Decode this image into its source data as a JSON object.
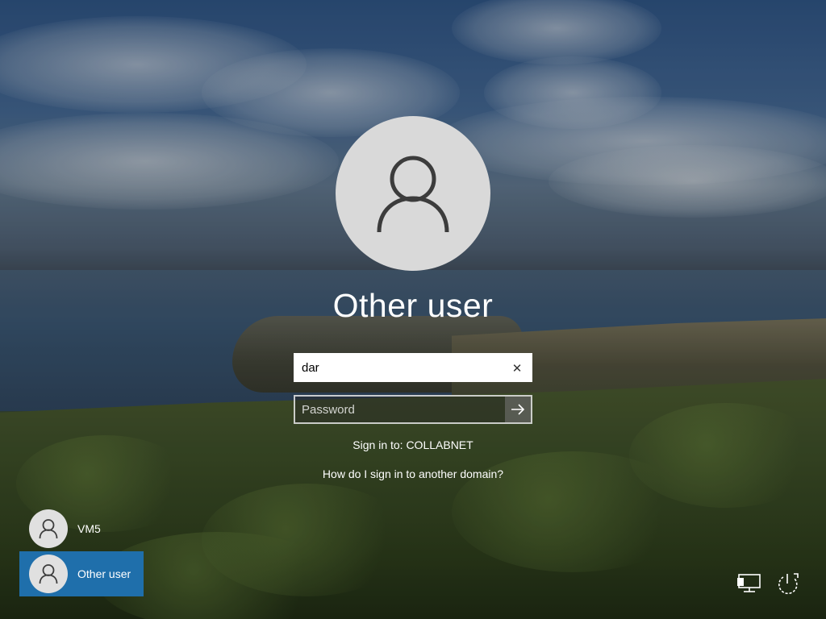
{
  "login": {
    "display_name": "Other user",
    "username_value": "dar",
    "password_placeholder": "Password",
    "sign_in_to": "Sign in to: COLLABNET",
    "domain_help_link": "How do I sign in to another domain?"
  },
  "users": [
    {
      "name": "VM5",
      "selected": false
    },
    {
      "name": "Other user",
      "selected": true
    }
  ],
  "icons": {
    "clear": "close-icon",
    "submit": "arrow-right-icon",
    "network": "network-icon",
    "power": "power-icon"
  },
  "colors": {
    "selected_tile": "#1f6fab",
    "avatar_bg": "#d9d9d9"
  }
}
